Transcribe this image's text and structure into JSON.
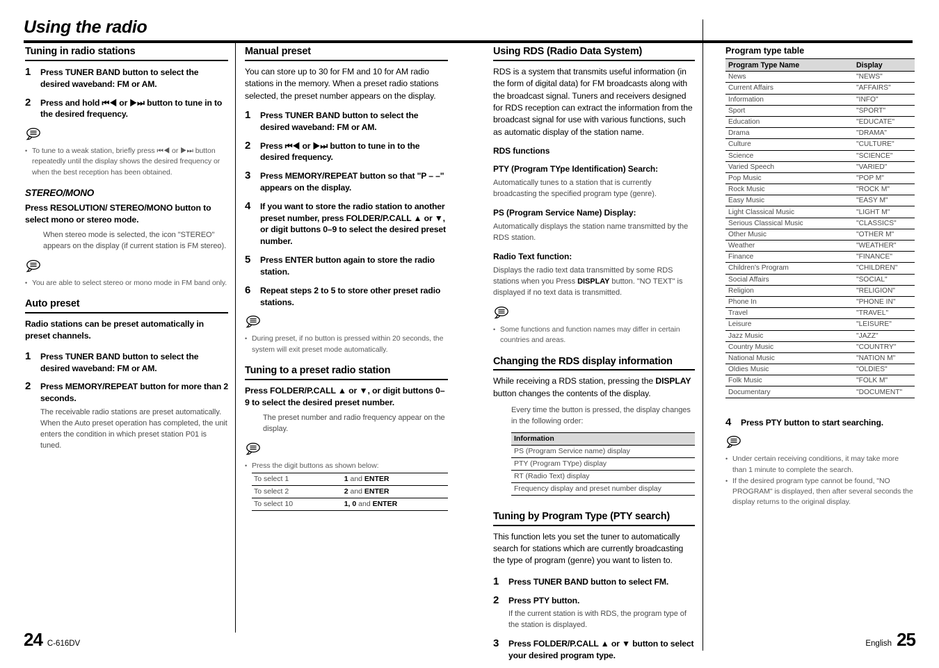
{
  "document": {
    "title": "Using the radio",
    "footer_left_page": "24",
    "footer_left_model": "C-616DV",
    "footer_right_lang": "English",
    "footer_right_page": "25"
  },
  "col1": {
    "section1": {
      "heading": "Tuning in radio stations",
      "steps": [
        {
          "num": "1",
          "text": "Press TUNER BAND button to select the desired waveband: FM or AM."
        },
        {
          "num": "2",
          "text": "Press and hold ⏮◀ or ▶⏭ button to tune in to the desired frequency."
        }
      ],
      "note": "To tune to a weak station, briefly press ⏮◀ or ▶⏭ button repeatedly until the display shows the desired frequency or when the best reception has been obtained."
    },
    "stereo_mono": {
      "heading": "STEREO/MONO",
      "bold": "Press RESOLUTION/ STEREO/MONO button to select mono or stereo mode.",
      "grey": "When stereo mode is selected, the icon \"STEREO\" appears on the display (if current station is FM stereo).",
      "note": "You are able to select stereo or mono mode in FM band only."
    },
    "auto_preset": {
      "heading": "Auto preset",
      "bold": "Radio stations can be preset automatically in preset channels.",
      "steps": [
        {
          "num": "1",
          "text": "Press TUNER BAND button to select the desired waveband: FM or AM.",
          "note": ""
        },
        {
          "num": "2",
          "text": "Press MEMORY/REPEAT button for more than 2 seconds.",
          "note": "The receivable radio stations are preset automatically.\nWhen the Auto preset operation has completed, the unit enters the condition in which preset station P01 is tuned."
        }
      ]
    }
  },
  "col2": {
    "manual_preset": {
      "heading": "Manual preset",
      "intro": "You can store up to 30 for FM and 10 for AM radio stations in the memory. When a preset radio stations selected, the preset number appears on the display.",
      "steps": [
        {
          "num": "1",
          "text": "Press TUNER BAND button to select the desired waveband: FM or AM."
        },
        {
          "num": "2",
          "text": "Press ⏮◀ or ▶⏭ button to tune in to the desired frequency."
        },
        {
          "num": "3",
          "text": "Press MEMORY/REPEAT button so that \"P – –\" appears on the display."
        },
        {
          "num": "4",
          "text": "If you want to store the radio station to another preset number, press FOLDER/P.CALL ▲ or ▼, or digit buttons 0–9 to select the desired preset number."
        },
        {
          "num": "5",
          "text": "Press ENTER button again to store the radio station."
        },
        {
          "num": "6",
          "text": "Repeat steps 2 to 5 to store other preset radio stations."
        }
      ],
      "note": "During preset, if no button is pressed within 20 seconds, the system will exit preset mode automatically."
    },
    "preset_tuning": {
      "heading": "Tuning to a preset radio station",
      "bold": "Press FOLDER/P.CALL ▲ or ▼, or digit buttons 0–9 to select the desired preset number.",
      "grey": "The preset number and radio frequency appear on the display.",
      "note": "Press the digit buttons as shown below:",
      "table": [
        {
          "key": "To select 1",
          "val_bold1": "1",
          "val_mid": " and ",
          "val_bold2": "ENTER"
        },
        {
          "key": "To select 2",
          "val_bold1": "2",
          "val_mid": " and ",
          "val_bold2": "ENTER"
        },
        {
          "key": "To select 10",
          "val_bold1": "1, 0",
          "val_mid": " and ",
          "val_bold2": "ENTER"
        }
      ]
    }
  },
  "col3": {
    "rds": {
      "heading": "Using RDS (Radio Data System)",
      "intro": "RDS is a system that transmits useful information (in the form of digital data) for FM broadcasts along with the broadcast signal. Tuners and receivers designed for RDS reception can extract the information from the broadcast signal for use with various functions, such as automatic display of the station name.",
      "functions_label": "RDS functions",
      "pty_label": "PTY (Program TYpe Identification) Search:",
      "pty_text": "Automatically tunes to a station that is currently broadcasting the specified program type (genre).",
      "ps_label": "PS (Program Service Name) Display:",
      "ps_text": "Automatically displays the station name transmitted by the RDS station.",
      "rt_label": "Radio Text function:",
      "rt_text_a": "Displays the radio text data transmitted by some RDS stations when you Press ",
      "rt_text_b": "DISPLAY",
      "rt_text_c": " button. \"NO TEXT\" is displayed if no text data is transmitted.",
      "note": "Some functions and function names may differ in certain countries and areas."
    },
    "changing_rds": {
      "heading": "Changing the RDS display information",
      "intro_a": "While receiving a RDS station, pressing the ",
      "intro_b": "DISPLAY",
      "intro_c": " button changes the contents of the display.",
      "grey": "Every time the button is pressed, the display changes in the following order:",
      "table_header": "Information",
      "table_rows": [
        "PS (Program Service name) display",
        "PTY (Program TYpe) display",
        "RT (Radio Text) display",
        "Frequency display and preset number display"
      ]
    },
    "pty_search": {
      "heading": "Tuning by Program Type (PTY search)",
      "intro": "This function lets you set the tuner to automatically search for stations which are currently broadcasting the type of program (genre) you want to listen to.",
      "steps": [
        {
          "num": "1",
          "text": "Press TUNER BAND button to select FM.",
          "note": ""
        },
        {
          "num": "2",
          "text": "Press PTY button.",
          "note": "If the current station is with RDS, the program type of the station is displayed."
        },
        {
          "num": "3",
          "text": "Press FOLDER/P.CALL ▲ or ▼ button to select your desired program type.",
          "note": ""
        }
      ]
    }
  },
  "col4": {
    "table_title": "Program type table",
    "headers": {
      "name": "Program Type Name",
      "display": "Display"
    },
    "rows": [
      {
        "name": "News",
        "display": "\"NEWS\""
      },
      {
        "name": "Current Affairs",
        "display": "\"AFFAIRS\""
      },
      {
        "name": "Information",
        "display": "\"INFO\""
      },
      {
        "name": "Sport",
        "display": "\"SPORT\""
      },
      {
        "name": "Education",
        "display": "\"EDUCATE\""
      },
      {
        "name": "Drama",
        "display": "\"DRAMA\""
      },
      {
        "name": "Culture",
        "display": "\"CULTURE\""
      },
      {
        "name": "Science",
        "display": "\"SCIENCE\""
      },
      {
        "name": "Varied Speech",
        "display": "\"VARIED\""
      },
      {
        "name": "Pop Music",
        "display": "\"POP M\""
      },
      {
        "name": "Rock Music",
        "display": "\"ROCK M\""
      },
      {
        "name": "Easy Music",
        "display": "\"EASY M\""
      },
      {
        "name": "Light Classical Music",
        "display": "\"LIGHT M\""
      },
      {
        "name": "Serious Classical Music",
        "display": "\"CLASSICS\""
      },
      {
        "name": "Other Music",
        "display": "\"OTHER M\""
      },
      {
        "name": "Weather",
        "display": "\"WEATHER\""
      },
      {
        "name": "Finance",
        "display": "\"FINANCE\""
      },
      {
        "name": "Children's Program",
        "display": "\"CHILDREN\""
      },
      {
        "name": "Social Affairs",
        "display": "\"SOCIAL\""
      },
      {
        "name": "Religion",
        "display": "\"RELIGION\""
      },
      {
        "name": "Phone In",
        "display": "\"PHONE IN\""
      },
      {
        "name": "Travel",
        "display": "\"TRAVEL\""
      },
      {
        "name": "Leisure",
        "display": "\"LEISURE\""
      },
      {
        "name": "Jazz Music",
        "display": "\"JAZZ\""
      },
      {
        "name": "Country Music",
        "display": "\"COUNTRY\""
      },
      {
        "name": "National Music",
        "display": "\"NATION M\""
      },
      {
        "name": "Oldies Music",
        "display": "\"OLDIES\""
      },
      {
        "name": "Folk Music",
        "display": "\"FOLK M\""
      },
      {
        "name": "Documentary",
        "display": "\"DOCUMENT\""
      }
    ],
    "step4": {
      "num": "4",
      "text": "Press PTY button to start searching."
    },
    "notes": [
      "Under certain receiving conditions, it may take more than 1 minute to complete the search.",
      "If the desired program type cannot be found, \"NO PROGRAM\" is displayed, then after several seconds the display returns to the original display."
    ]
  },
  "icons": {
    "note_bubble": "note-bubble-icon"
  }
}
